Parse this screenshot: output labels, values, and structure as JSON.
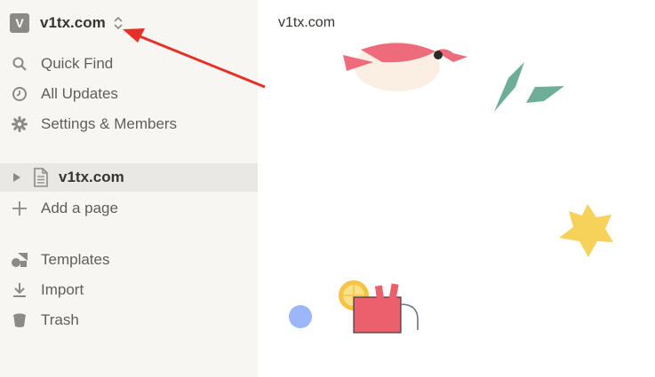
{
  "workspace": {
    "initial": "V",
    "name": "v1tx.com"
  },
  "nav": {
    "quick_find": "Quick Find",
    "all_updates": "All Updates",
    "settings": "Settings & Members"
  },
  "pages": {
    "current": "v1tx.com",
    "add_page": "Add a page"
  },
  "tools": {
    "templates": "Templates",
    "import": "Import",
    "trash": "Trash"
  },
  "main": {
    "title": "v1tx.com"
  },
  "colors": {
    "sidebar_bg": "#f7f6f3",
    "active_row": "#e9e8e5",
    "annotation_arrow": "#e8302a"
  }
}
